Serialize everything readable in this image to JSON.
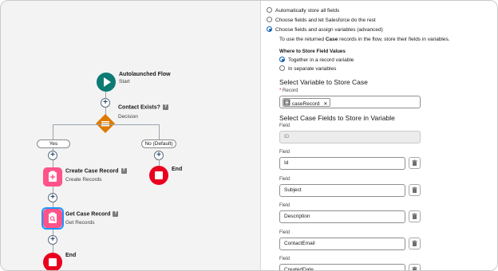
{
  "canvas": {
    "start": {
      "title": "Autolaunched Flow",
      "sub": "Start"
    },
    "decision": {
      "title": "Contact Exists?",
      "sub": "Decision"
    },
    "branch_yes": "Yes",
    "branch_no": "No (Default)",
    "create": {
      "title": "Create Case Record",
      "sub": "Create Records"
    },
    "get": {
      "title": "Get Case Record",
      "sub": "Get Records"
    },
    "end_right": "End",
    "end_bottom": "End",
    "plus_glyph": "+"
  },
  "panel": {
    "options": [
      {
        "label": "Automatically store all fields",
        "selected": false
      },
      {
        "label": "Choose fields and let Salesforce do the rest",
        "selected": false
      },
      {
        "label": "Choose fields and assign variables (advanced)",
        "selected": true
      }
    ],
    "help_pre": "To use the returned ",
    "help_bold": "Case",
    "help_post": " records in the flow, store their fields in variables.",
    "where_label": "Where to Store Field Values",
    "where_options": [
      {
        "label": "Together in a record variable",
        "selected": true
      },
      {
        "label": "In separate variables",
        "selected": false
      }
    ],
    "select_variable_heading": "Select Variable to Store Case",
    "record_required_mark": "*",
    "record_label": "Record",
    "record_value": "caseRecord",
    "remove_glyph": "✕",
    "fields_heading": "Select Case Fields to Store in Variable",
    "field_label": "Field",
    "fields": [
      "ID",
      "Id",
      "Subject",
      "Description",
      "ContactEmail",
      "CreatedDate"
    ]
  }
}
